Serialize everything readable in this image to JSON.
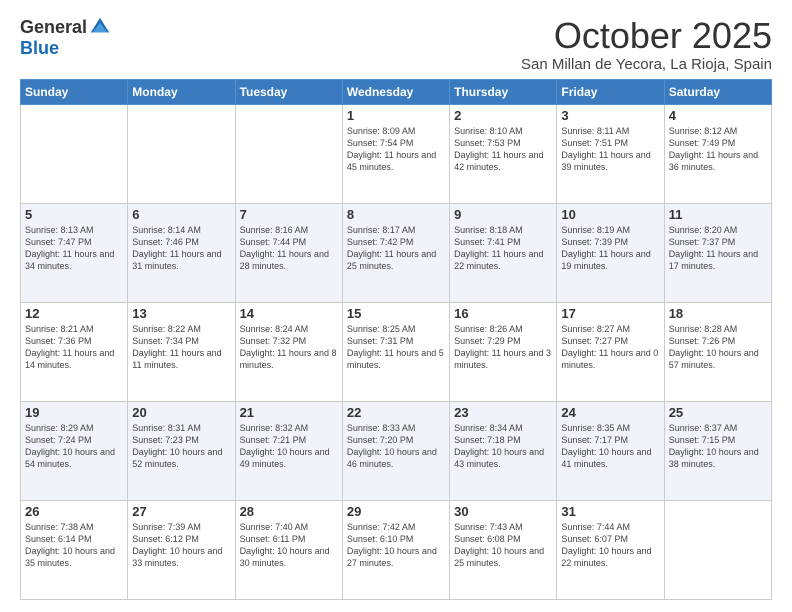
{
  "header": {
    "logo_general": "General",
    "logo_blue": "Blue",
    "month_title": "October 2025",
    "subtitle": "San Millan de Yecora, La Rioja, Spain"
  },
  "weekdays": [
    "Sunday",
    "Monday",
    "Tuesday",
    "Wednesday",
    "Thursday",
    "Friday",
    "Saturday"
  ],
  "weeks": [
    [
      {
        "day": "",
        "sunrise": "",
        "sunset": "",
        "daylight": ""
      },
      {
        "day": "",
        "sunrise": "",
        "sunset": "",
        "daylight": ""
      },
      {
        "day": "",
        "sunrise": "",
        "sunset": "",
        "daylight": ""
      },
      {
        "day": "1",
        "sunrise": "Sunrise: 8:09 AM",
        "sunset": "Sunset: 7:54 PM",
        "daylight": "Daylight: 11 hours and 45 minutes."
      },
      {
        "day": "2",
        "sunrise": "Sunrise: 8:10 AM",
        "sunset": "Sunset: 7:53 PM",
        "daylight": "Daylight: 11 hours and 42 minutes."
      },
      {
        "day": "3",
        "sunrise": "Sunrise: 8:11 AM",
        "sunset": "Sunset: 7:51 PM",
        "daylight": "Daylight: 11 hours and 39 minutes."
      },
      {
        "day": "4",
        "sunrise": "Sunrise: 8:12 AM",
        "sunset": "Sunset: 7:49 PM",
        "daylight": "Daylight: 11 hours and 36 minutes."
      }
    ],
    [
      {
        "day": "5",
        "sunrise": "Sunrise: 8:13 AM",
        "sunset": "Sunset: 7:47 PM",
        "daylight": "Daylight: 11 hours and 34 minutes."
      },
      {
        "day": "6",
        "sunrise": "Sunrise: 8:14 AM",
        "sunset": "Sunset: 7:46 PM",
        "daylight": "Daylight: 11 hours and 31 minutes."
      },
      {
        "day": "7",
        "sunrise": "Sunrise: 8:16 AM",
        "sunset": "Sunset: 7:44 PM",
        "daylight": "Daylight: 11 hours and 28 minutes."
      },
      {
        "day": "8",
        "sunrise": "Sunrise: 8:17 AM",
        "sunset": "Sunset: 7:42 PM",
        "daylight": "Daylight: 11 hours and 25 minutes."
      },
      {
        "day": "9",
        "sunrise": "Sunrise: 8:18 AM",
        "sunset": "Sunset: 7:41 PM",
        "daylight": "Daylight: 11 hours and 22 minutes."
      },
      {
        "day": "10",
        "sunrise": "Sunrise: 8:19 AM",
        "sunset": "Sunset: 7:39 PM",
        "daylight": "Daylight: 11 hours and 19 minutes."
      },
      {
        "day": "11",
        "sunrise": "Sunrise: 8:20 AM",
        "sunset": "Sunset: 7:37 PM",
        "daylight": "Daylight: 11 hours and 17 minutes."
      }
    ],
    [
      {
        "day": "12",
        "sunrise": "Sunrise: 8:21 AM",
        "sunset": "Sunset: 7:36 PM",
        "daylight": "Daylight: 11 hours and 14 minutes."
      },
      {
        "day": "13",
        "sunrise": "Sunrise: 8:22 AM",
        "sunset": "Sunset: 7:34 PM",
        "daylight": "Daylight: 11 hours and 11 minutes."
      },
      {
        "day": "14",
        "sunrise": "Sunrise: 8:24 AM",
        "sunset": "Sunset: 7:32 PM",
        "daylight": "Daylight: 11 hours and 8 minutes."
      },
      {
        "day": "15",
        "sunrise": "Sunrise: 8:25 AM",
        "sunset": "Sunset: 7:31 PM",
        "daylight": "Daylight: 11 hours and 5 minutes."
      },
      {
        "day": "16",
        "sunrise": "Sunrise: 8:26 AM",
        "sunset": "Sunset: 7:29 PM",
        "daylight": "Daylight: 11 hours and 3 minutes."
      },
      {
        "day": "17",
        "sunrise": "Sunrise: 8:27 AM",
        "sunset": "Sunset: 7:27 PM",
        "daylight": "Daylight: 11 hours and 0 minutes."
      },
      {
        "day": "18",
        "sunrise": "Sunrise: 8:28 AM",
        "sunset": "Sunset: 7:26 PM",
        "daylight": "Daylight: 10 hours and 57 minutes."
      }
    ],
    [
      {
        "day": "19",
        "sunrise": "Sunrise: 8:29 AM",
        "sunset": "Sunset: 7:24 PM",
        "daylight": "Daylight: 10 hours and 54 minutes."
      },
      {
        "day": "20",
        "sunrise": "Sunrise: 8:31 AM",
        "sunset": "Sunset: 7:23 PM",
        "daylight": "Daylight: 10 hours and 52 minutes."
      },
      {
        "day": "21",
        "sunrise": "Sunrise: 8:32 AM",
        "sunset": "Sunset: 7:21 PM",
        "daylight": "Daylight: 10 hours and 49 minutes."
      },
      {
        "day": "22",
        "sunrise": "Sunrise: 8:33 AM",
        "sunset": "Sunset: 7:20 PM",
        "daylight": "Daylight: 10 hours and 46 minutes."
      },
      {
        "day": "23",
        "sunrise": "Sunrise: 8:34 AM",
        "sunset": "Sunset: 7:18 PM",
        "daylight": "Daylight: 10 hours and 43 minutes."
      },
      {
        "day": "24",
        "sunrise": "Sunrise: 8:35 AM",
        "sunset": "Sunset: 7:17 PM",
        "daylight": "Daylight: 10 hours and 41 minutes."
      },
      {
        "day": "25",
        "sunrise": "Sunrise: 8:37 AM",
        "sunset": "Sunset: 7:15 PM",
        "daylight": "Daylight: 10 hours and 38 minutes."
      }
    ],
    [
      {
        "day": "26",
        "sunrise": "Sunrise: 7:38 AM",
        "sunset": "Sunset: 6:14 PM",
        "daylight": "Daylight: 10 hours and 35 minutes."
      },
      {
        "day": "27",
        "sunrise": "Sunrise: 7:39 AM",
        "sunset": "Sunset: 6:12 PM",
        "daylight": "Daylight: 10 hours and 33 minutes."
      },
      {
        "day": "28",
        "sunrise": "Sunrise: 7:40 AM",
        "sunset": "Sunset: 6:11 PM",
        "daylight": "Daylight: 10 hours and 30 minutes."
      },
      {
        "day": "29",
        "sunrise": "Sunrise: 7:42 AM",
        "sunset": "Sunset: 6:10 PM",
        "daylight": "Daylight: 10 hours and 27 minutes."
      },
      {
        "day": "30",
        "sunrise": "Sunrise: 7:43 AM",
        "sunset": "Sunset: 6:08 PM",
        "daylight": "Daylight: 10 hours and 25 minutes."
      },
      {
        "day": "31",
        "sunrise": "Sunrise: 7:44 AM",
        "sunset": "Sunset: 6:07 PM",
        "daylight": "Daylight: 10 hours and 22 minutes."
      },
      {
        "day": "",
        "sunrise": "",
        "sunset": "",
        "daylight": ""
      }
    ]
  ]
}
